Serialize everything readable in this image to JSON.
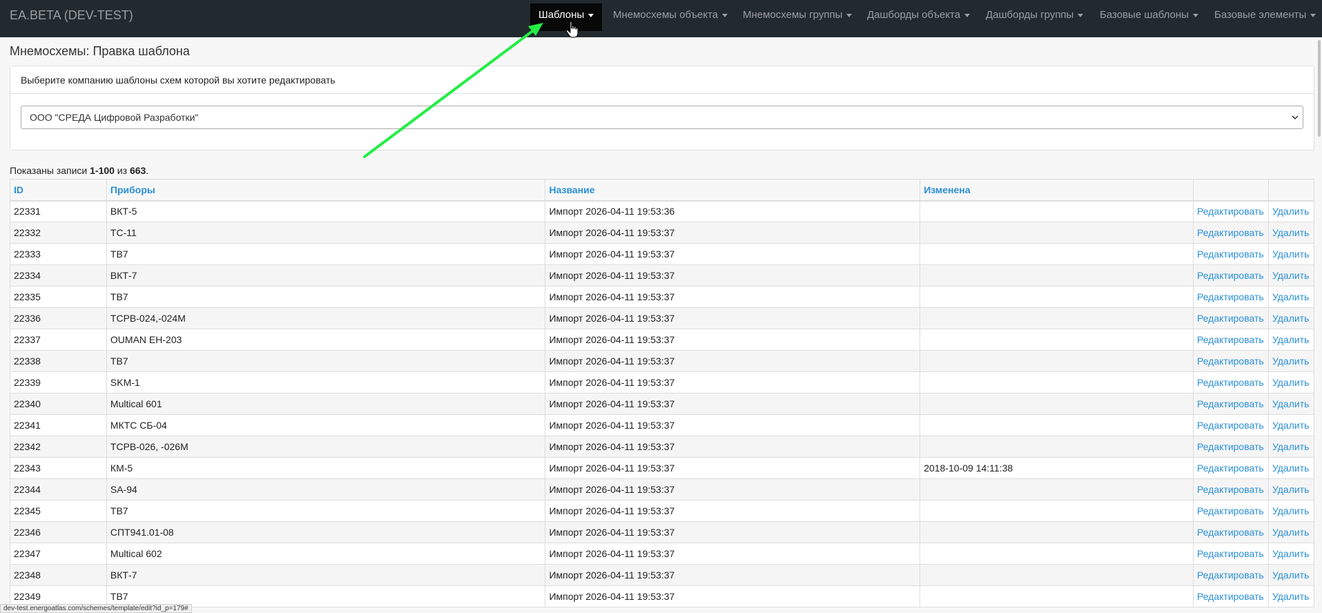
{
  "navbar": {
    "brand": "EA.BETA (DEV-TEST)",
    "items": [
      {
        "label": "Шаблоны"
      },
      {
        "label": "Мнемосхемы объекта"
      },
      {
        "label": "Мнемосхемы группы"
      },
      {
        "label": "Дашборды объекта"
      },
      {
        "label": "Дашборды группы"
      },
      {
        "label": "Базовые шаблоны"
      },
      {
        "label": "Базовые элементы"
      }
    ]
  },
  "page": {
    "title": "Мнемосхемы: Правка шаблона"
  },
  "company_panel": {
    "heading": "Выберите компанию шаблоны схем которой вы хотите редактировать",
    "selected_company": "ООО \"СРЕДА Цифровой Разработки\""
  },
  "summary": {
    "prefix": "Показаны записи ",
    "range": "1-100",
    "middle": " из ",
    "total": "663",
    "suffix": "."
  },
  "table": {
    "headers": {
      "id": "ID",
      "devices": "Приборы",
      "name": "Название",
      "modified": "Изменена"
    },
    "edit_label": "Редактировать",
    "delete_label": "Удалить",
    "rows": [
      {
        "id": "22331",
        "device": "ВКТ-5",
        "name": "Импорт 2026-04-11 19:53:36",
        "modified": ""
      },
      {
        "id": "22332",
        "device": "ТС-11",
        "name": "Импорт 2026-04-11 19:53:37",
        "modified": ""
      },
      {
        "id": "22333",
        "device": "ТВ7",
        "name": "Импорт 2026-04-11 19:53:37",
        "modified": ""
      },
      {
        "id": "22334",
        "device": "ВКТ-7",
        "name": "Импорт 2026-04-11 19:53:37",
        "modified": ""
      },
      {
        "id": "22335",
        "device": "ТВ7",
        "name": "Импорт 2026-04-11 19:53:37",
        "modified": ""
      },
      {
        "id": "22336",
        "device": "ТСРВ-024,-024М",
        "name": "Импорт 2026-04-11 19:53:37",
        "modified": ""
      },
      {
        "id": "22337",
        "device": "OUMAN EH-203",
        "name": "Импорт 2026-04-11 19:53:37",
        "modified": ""
      },
      {
        "id": "22338",
        "device": "ТВ7",
        "name": "Импорт 2026-04-11 19:53:37",
        "modified": ""
      },
      {
        "id": "22339",
        "device": "SKM-1",
        "name": "Импорт 2026-04-11 19:53:37",
        "modified": ""
      },
      {
        "id": "22340",
        "device": "Multical 601",
        "name": "Импорт 2026-04-11 19:53:37",
        "modified": ""
      },
      {
        "id": "22341",
        "device": "МКТС СБ-04",
        "name": "Импорт 2026-04-11 19:53:37",
        "modified": ""
      },
      {
        "id": "22342",
        "device": "ТСРВ-026, -026М",
        "name": "Импорт 2026-04-11 19:53:37",
        "modified": ""
      },
      {
        "id": "22343",
        "device": "КМ-5",
        "name": "Импорт 2026-04-11 19:53:37",
        "modified": "2018-10-09 14:11:38"
      },
      {
        "id": "22344",
        "device": "SA-94",
        "name": "Импорт 2026-04-11 19:53:37",
        "modified": ""
      },
      {
        "id": "22345",
        "device": "ТВ7",
        "name": "Импорт 2026-04-11 19:53:37",
        "modified": ""
      },
      {
        "id": "22346",
        "device": "СПТ941.01-08",
        "name": "Импорт 2026-04-11 19:53:37",
        "modified": ""
      },
      {
        "id": "22347",
        "device": "Multical 602",
        "name": "Импорт 2026-04-11 19:53:37",
        "modified": ""
      },
      {
        "id": "22348",
        "device": "ВКТ-7",
        "name": "Импорт 2026-04-11 19:53:37",
        "modified": ""
      },
      {
        "id": "22349",
        "device": "ТВ7",
        "name": "Импорт 2026-04-11 19:53:37",
        "modified": ""
      }
    ]
  },
  "status_bar": {
    "url": "dev-test.energoatlas.com/schemes/template/edit?id_p=179#"
  },
  "colors": {
    "navbar_bg": "#222a30",
    "link": "#2a8fd6",
    "annotation_arrow": "#22ee44"
  },
  "icons": {
    "cursor": "hand-pointer-icon",
    "select": "chevron-down-icon",
    "nav_caret": "caret-down-icon"
  }
}
